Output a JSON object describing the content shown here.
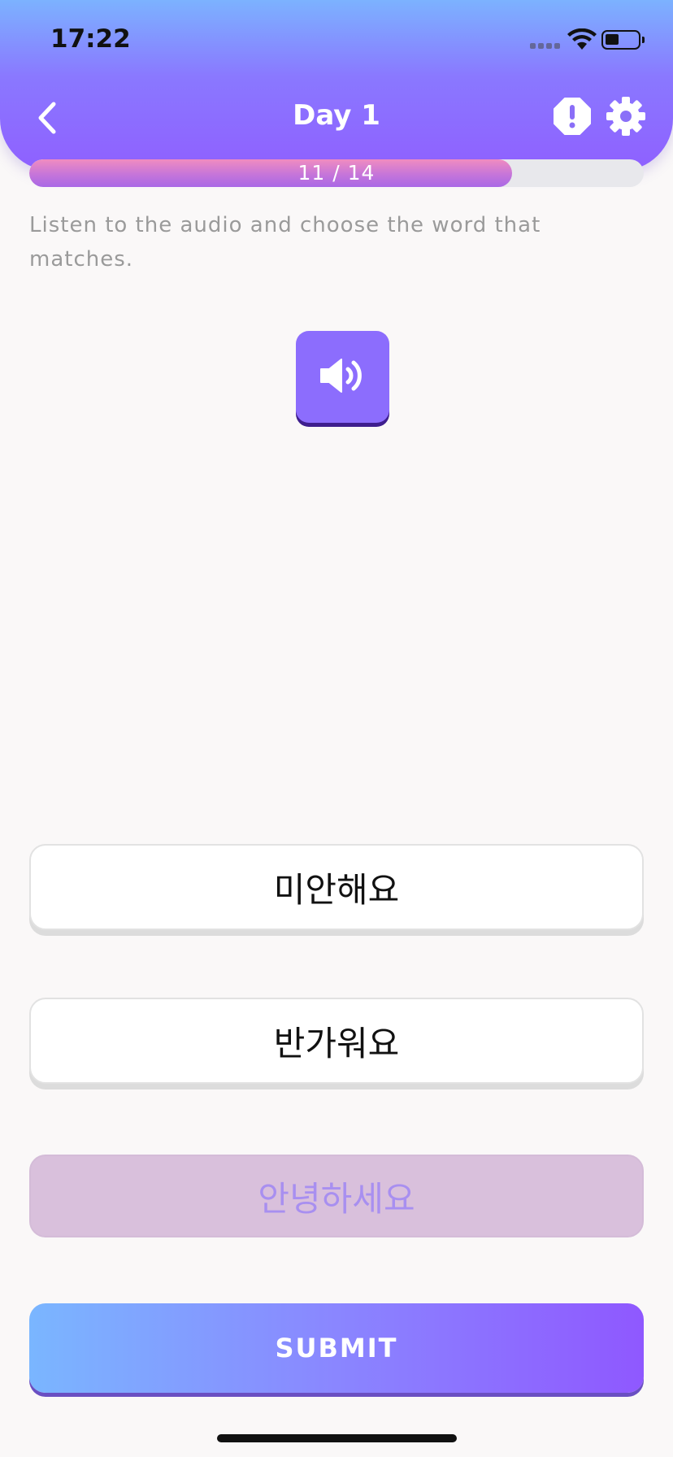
{
  "status_bar": {
    "time": "17:22"
  },
  "header": {
    "title": "Day 1"
  },
  "progress": {
    "label": "11 / 14",
    "current": 11,
    "total": 14
  },
  "instruction": "Listen to the audio and choose the word that matches.",
  "options": [
    {
      "text": "미안해요",
      "selected": false
    },
    {
      "text": "반가워요",
      "selected": false
    },
    {
      "text": "안녕하세요",
      "selected": true
    }
  ],
  "submit_label": "SUBMIT",
  "colors": {
    "header_top": "#7cb2ff",
    "header_bottom": "#8f60ff",
    "accent": "#8c6dfd",
    "selected_bg": "#d9c0dc",
    "selected_text": "#a88ff0"
  },
  "icons": {
    "back": "chevron-left-icon",
    "report": "alert-octagon-icon",
    "settings": "gear-icon",
    "audio": "speaker-icon"
  }
}
